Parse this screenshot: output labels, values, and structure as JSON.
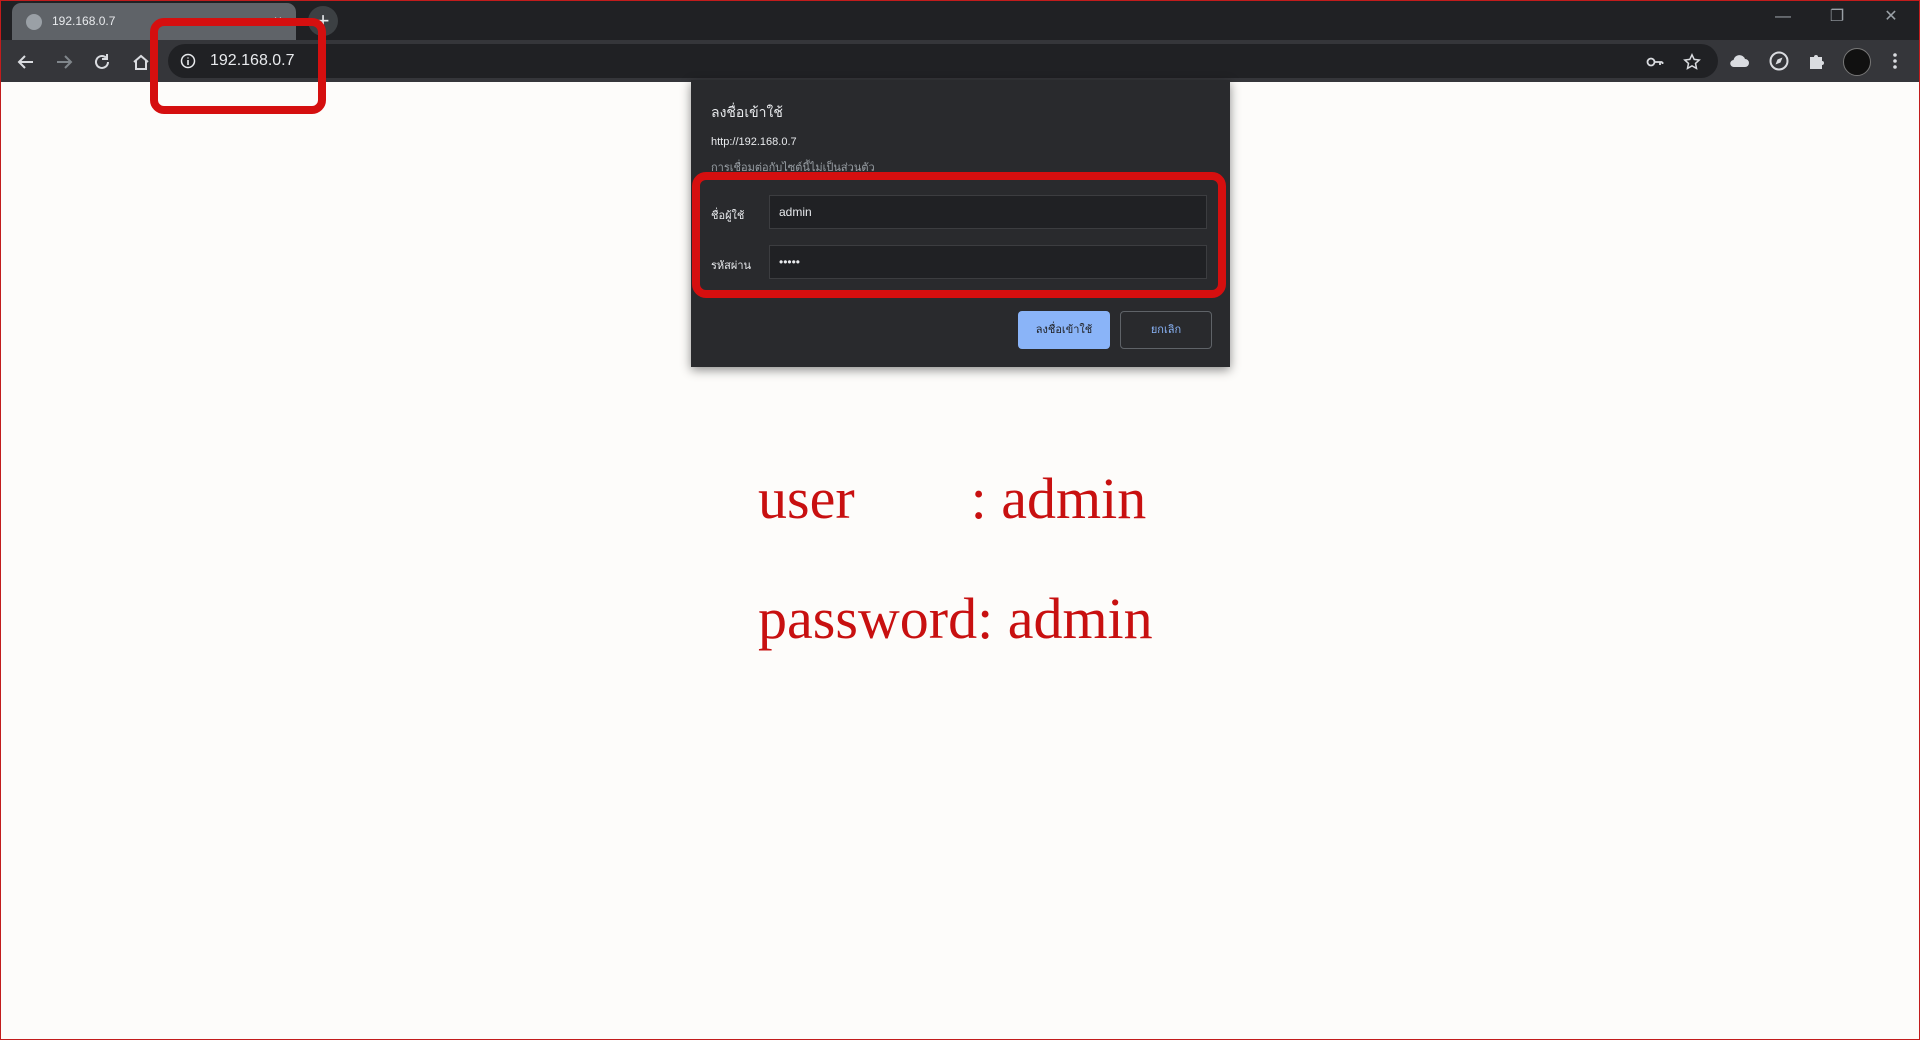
{
  "tab": {
    "title": "192.168.0.7",
    "close": "×",
    "new_tab": "+"
  },
  "window_controls": {
    "minimize": "—",
    "restore": "❐",
    "close": "✕"
  },
  "omnibox": {
    "url": "192.168.0.7"
  },
  "dialog": {
    "title": "ลงชื่อเข้าใช้",
    "url": "http://192.168.0.7",
    "warning": "การเชื่อมต่อกับไซต์นี้ไม่เป็นส่วนตัว",
    "username_label": "ชื่อผู้ใช้",
    "username_value": "admin",
    "password_label": "รหัสผ่าน",
    "password_value": "•••••",
    "signin_button": "ลงชื่อเข้าใช้",
    "cancel_button": "ยกเลิก"
  },
  "page": {
    "user_line": "user        : admin",
    "password_line": "password: admin"
  },
  "colors": {
    "annotation_red": "#d50f0f",
    "text_red": "#c81010",
    "primary_button": "#8ab4f8"
  },
  "icons": [
    "back-icon",
    "forward-icon",
    "reload-icon",
    "home-icon",
    "info-icon",
    "key-icon",
    "star-icon",
    "cloud-icon",
    "compass-icon",
    "puzzle-icon",
    "menu-icon"
  ]
}
